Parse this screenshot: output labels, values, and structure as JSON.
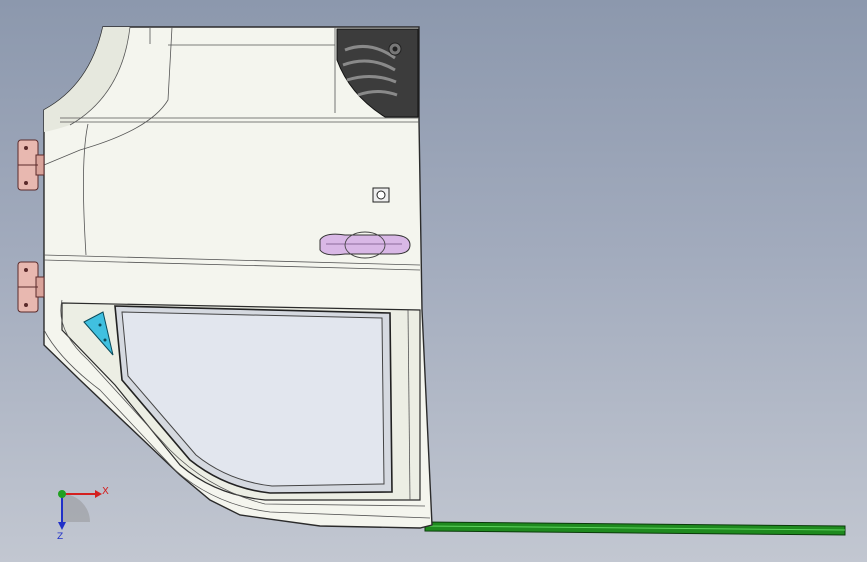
{
  "viewport": {
    "background_top": "#8c98ad",
    "background_bottom": "#c2c7d1"
  },
  "model": {
    "panel_color": "#f4f5ee",
    "outline_color": "#2b2b2b",
    "glass_color": "#e2e6ee",
    "hinge_color": "#e8b8b0",
    "handle_color": "#d9b8e6",
    "bracket_color": "#40c0e0",
    "rail_color": "#1e8a1e"
  },
  "triad": {
    "x_label": "X",
    "z_label": "Z",
    "x_color": "#d42020",
    "y_color": "#20a020",
    "z_color": "#2030c8"
  }
}
